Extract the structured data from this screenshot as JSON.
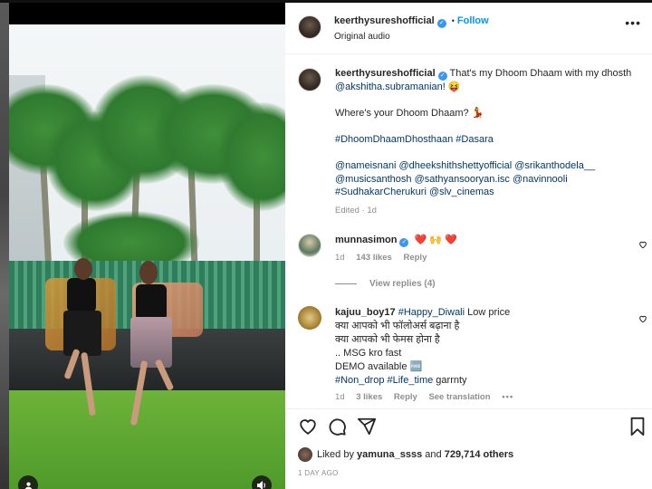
{
  "post": {
    "username": "keerthysureshofficial",
    "follow_label": "Follow",
    "separator": "•",
    "audio": "Original audio",
    "more_label": "•••"
  },
  "caption": {
    "username": "keerthysureshofficial",
    "line1": "That's my Dhoom Dhaam with my dhosth",
    "mention": "@akshitha.subramanian!",
    "emoji1": "😝",
    "question": "Where's your Dhoom Dhaam?",
    "emoji2": "💃",
    "hashtags": "#DhoomDhaamDhosthaan #Dasara",
    "credits": "@nameisnani @dheekshithshettyofficial @srikanthodela__ @musicsanthosh @sathyansooryan.isc @navinnooli #SudhakarCherukuri @slv_cinemas",
    "edited": "Edited",
    "dot": "·",
    "time": "1d"
  },
  "comments": [
    {
      "username": "munnasimon",
      "text": "❤️ 🙌 ❤️",
      "time": "1d",
      "likes": "143 likes",
      "reply": "Reply",
      "view_replies": "View replies (4)"
    },
    {
      "username": "kajuu_boy17",
      "hashtag": "#Happy_Diwali",
      "text_rest": " Low price",
      "line2": "क्या आपको भी फॉलोअर्स बढ़ाना है",
      "line3": "क्या आपको भी फेमस होना है",
      "line4": ".. MSG kro fast",
      "line5": "DEMO available",
      "line5_badge": "🆓",
      "line6_tags": "#Non_drop #Life_time",
      "line6_rest": " garrnty",
      "time": "1d",
      "likes": "3 likes",
      "reply": "Reply",
      "see_translation": "See translation",
      "more": "•••"
    }
  ],
  "likes": {
    "liked_by": "Liked by",
    "user": "yamuna_ssss",
    "and": "and",
    "count": "729,714 others"
  },
  "time_ago": "1 DAY AGO",
  "colors": {
    "link": "#00376b",
    "follow": "#0095f6",
    "heart": "#ed4956",
    "verified": "#3897f0"
  },
  "icons": {
    "like": "heart-icon",
    "comment": "comment-icon",
    "share": "send-icon",
    "save": "bookmark-icon",
    "comment_like": "heart-outline-icon",
    "media_user": "user-icon",
    "media_audio": "speaker-icon"
  }
}
